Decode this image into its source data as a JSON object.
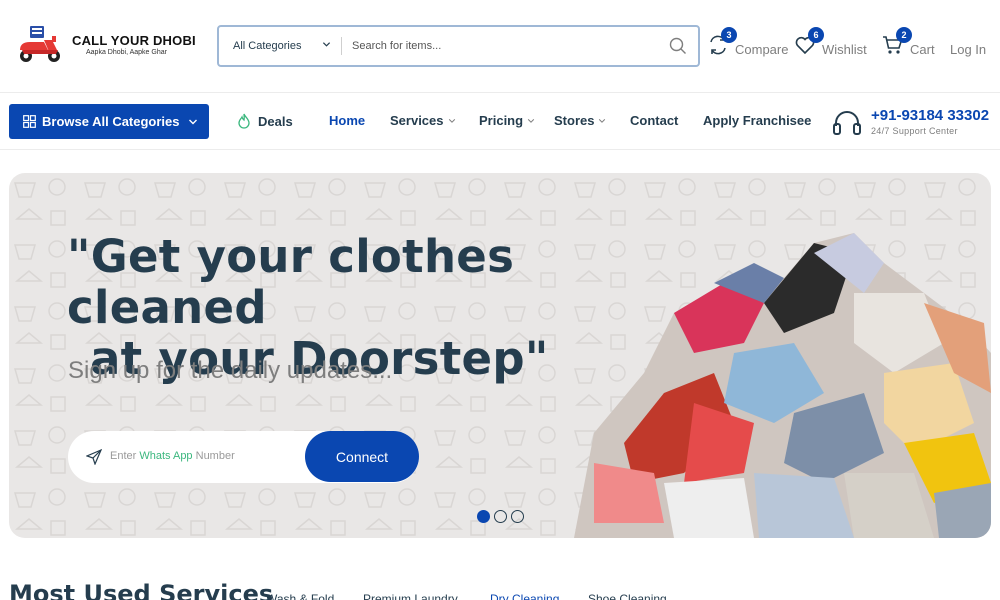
{
  "brand": {
    "name": "CALL YOUR DHOBI",
    "tagline": "Aapka Dhobi, Aapke Ghar"
  },
  "search": {
    "category_label": "All Categories",
    "placeholder": "Search for items..."
  },
  "header_actions": {
    "compare": {
      "label": "Compare",
      "count": "3"
    },
    "wishlist": {
      "label": "Wishlist",
      "count": "6"
    },
    "cart": {
      "label": "Cart",
      "count": "2"
    },
    "login": {
      "label": "Log In"
    }
  },
  "nav": {
    "browse_label": "Browse All Categories",
    "items": [
      {
        "label": "Deals"
      },
      {
        "label": "Home"
      },
      {
        "label": "Services"
      },
      {
        "label": "Pricing"
      },
      {
        "label": "Stores"
      },
      {
        "label": "Contact"
      },
      {
        "label": "Apply Franchisee"
      }
    ],
    "active": "Home"
  },
  "support": {
    "phone": "+91-93184 33302",
    "subtitle": "24/7 Support Center"
  },
  "hero": {
    "title_line1": "\"Get your clothes cleaned",
    "title_line2": "at your Doorstep\"",
    "subtitle": "Sign up for the daily updates...",
    "input_prefix": "Enter ",
    "input_highlight": "Whats App",
    "input_suffix": " Number",
    "button_label": "Connect",
    "slides_total": 3,
    "slide_active": 1
  },
  "services_section": {
    "title": "Most Used Services",
    "tabs": [
      "Wash & Fold",
      "Premium Laundry",
      "Dry Cleaning",
      "Shoe Cleaning"
    ],
    "active_tab": "Dry Cleaning"
  },
  "colors": {
    "brand_blue": "#0a47b1",
    "heading": "#253d4e",
    "muted": "#7e7e7e",
    "accent_green": "#3bb77e",
    "hero_bg": "#e9e7e6"
  }
}
